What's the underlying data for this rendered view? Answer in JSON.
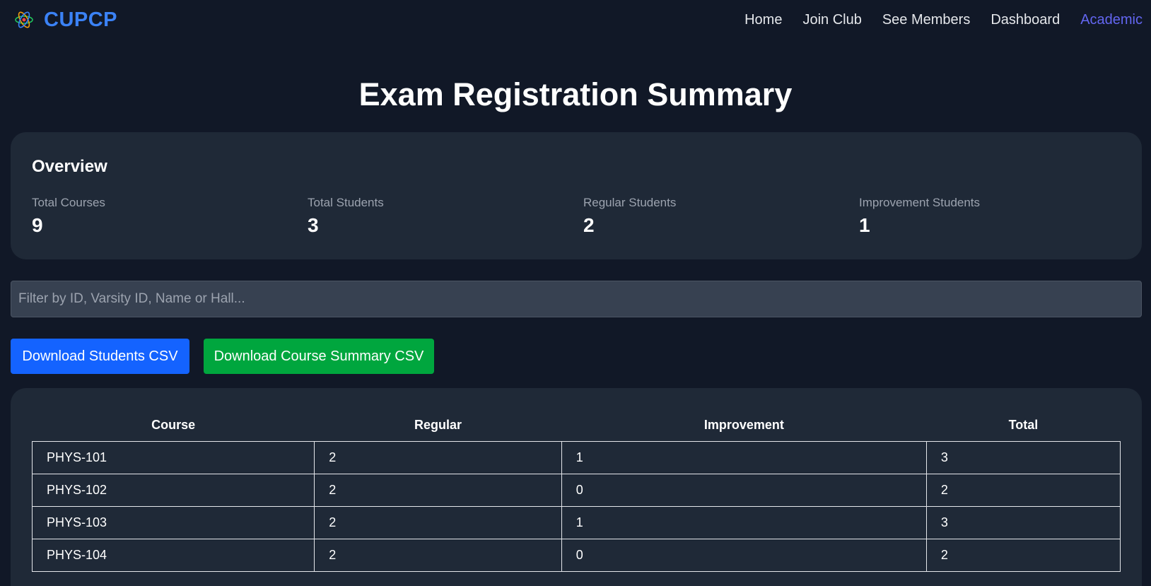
{
  "nav": {
    "brand": "CUPCP",
    "links": [
      "Home",
      "Join Club",
      "See Members",
      "Dashboard",
      "Academic"
    ]
  },
  "page": {
    "title": "Exam Registration Summary"
  },
  "overview": {
    "title": "Overview",
    "stats": [
      {
        "label": "Total Courses",
        "value": "9"
      },
      {
        "label": "Total Students",
        "value": "3"
      },
      {
        "label": "Regular Students",
        "value": "2"
      },
      {
        "label": "Improvement Students",
        "value": "1"
      }
    ]
  },
  "filter": {
    "placeholder": "Filter by ID, Varsity ID, Name or Hall..."
  },
  "buttons": {
    "students_csv": "Download Students CSV",
    "course_csv": "Download Course Summary CSV"
  },
  "table": {
    "headers": [
      "Course",
      "Regular",
      "Improvement",
      "Total"
    ],
    "rows": [
      [
        "PHYS-101",
        "2",
        "1",
        "3"
      ],
      [
        "PHYS-102",
        "2",
        "0",
        "2"
      ],
      [
        "PHYS-103",
        "2",
        "1",
        "3"
      ],
      [
        "PHYS-104",
        "2",
        "0",
        "2"
      ]
    ]
  },
  "colors": {
    "background": "#111827",
    "card": "#1f2937",
    "brand": "#3b82f6",
    "nav_active": "#6366f1",
    "primary_button": "#1463ff",
    "success_button": "#00a63e"
  }
}
